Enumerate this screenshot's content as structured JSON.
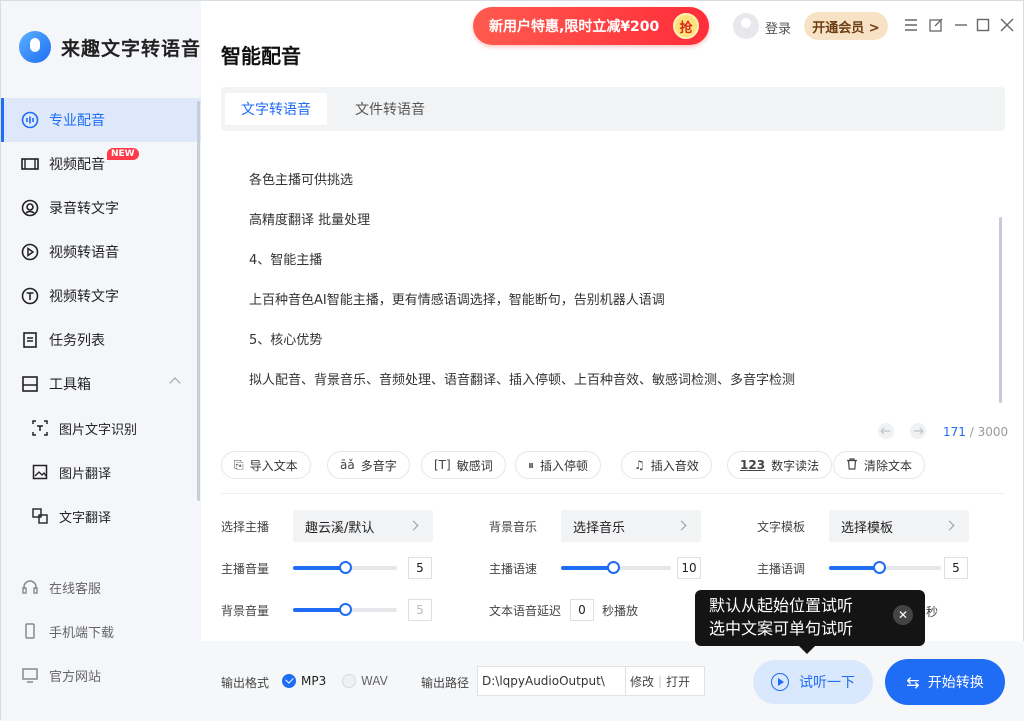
{
  "app": {
    "name": "来趣文字转语音",
    "page_title": "智能配音"
  },
  "header": {
    "promo_text": "新用户特惠,限时立减¥200",
    "promo_grab": "抢",
    "login": "登录",
    "vip": "开通会员 >",
    "window_controls": [
      "menu-icon",
      "feedback-icon",
      "minimize-icon",
      "maximize-icon",
      "close-icon"
    ]
  },
  "sidebar": {
    "items": [
      {
        "label": "专业配音",
        "icon": "voice-icon",
        "active": true
      },
      {
        "label": "视频配音",
        "icon": "video-icon",
        "badge": "NEW"
      },
      {
        "label": "录音转文字",
        "icon": "record-icon"
      },
      {
        "label": "视频转语音",
        "icon": "video-voice-icon"
      },
      {
        "label": "视频转文字",
        "icon": "video-text-icon"
      },
      {
        "label": "任务列表",
        "icon": "task-list-icon"
      },
      {
        "label": "工具箱",
        "icon": "toolbox-icon",
        "expanded": true
      }
    ],
    "sub_items": [
      {
        "label": "图片文字识别",
        "icon": "ocr-icon"
      },
      {
        "label": "图片翻译",
        "icon": "image-icon"
      },
      {
        "label": "文字翻译",
        "icon": "translate-icon"
      }
    ],
    "bottom": [
      {
        "label": "在线客服",
        "icon": "headset-icon"
      },
      {
        "label": "手机端下载",
        "icon": "phone-icon"
      },
      {
        "label": "官方网站",
        "icon": "monitor-icon"
      }
    ]
  },
  "tabs": [
    {
      "label": "文字转语音",
      "active": true
    },
    {
      "label": "文件转语音"
    }
  ],
  "editor": {
    "lines": [
      "各色主播可供挑选",
      "高精度翻译 批量处理",
      "4、智能主播",
      "上百种音色AI智能主播，更有情感语调选择，智能断句，告别机器人语调",
      "5、核心优势",
      "拟人配音、背景音乐、音频处理、语音翻译、插入停顿、上百种音效、敏感词检测、多音字检测"
    ],
    "char_count": "171",
    "char_limit": "/ 3000"
  },
  "toolbar": [
    {
      "label": "导入文本",
      "icon": "import-icon",
      "glyph": "⎘"
    },
    {
      "label": "多音字",
      "icon": "polyphone-icon",
      "glyph": "āǎ"
    },
    {
      "label": "敏感词",
      "icon": "sensitive-icon",
      "glyph": "[T]"
    },
    {
      "label": "插入停顿",
      "icon": "pause-icon",
      "glyph": "⏸"
    },
    {
      "label": "插入音效",
      "icon": "music-icon",
      "glyph": "♫"
    },
    {
      "label": "数字读法",
      "icon": "number-icon",
      "glyph": "123"
    },
    {
      "label": "清除文本",
      "icon": "trash-icon",
      "glyph": "🗑"
    }
  ],
  "settings": {
    "anchor_label": "选择主播",
    "anchor_value": "趣云溪/默认",
    "bgm_label": "背景音乐",
    "bgm_value": "选择音乐",
    "template_label": "文字模板",
    "template_value": "选择模板",
    "anchor_volume_label": "主播音量",
    "anchor_volume": "5",
    "anchor_volume_level": 0.5,
    "speed_label": "主播语速",
    "speed": "10",
    "speed_level": 0.47,
    "pitch_label": "主播语调",
    "pitch": "5",
    "pitch_level": 0.45,
    "bg_volume_label": "背景音量",
    "bg_volume": "5",
    "bg_volume_level": 0.5,
    "delay_label": "文本语音延迟",
    "delay": "0",
    "delay_unit": "秒播放"
  },
  "footer": {
    "format_label": "输出格式",
    "format_mp3": "MP3",
    "format_wav": "WAV",
    "path_label": "输出路径",
    "path_value": "D:\\lqpyAudioOutput\\",
    "modify": "修改",
    "open": "打开",
    "listen": "试听一下",
    "start": "开始转换"
  },
  "tooltip": {
    "line1": "默认从起始位置试听",
    "line2": "选中文案可单句试听",
    "peek": "秒"
  },
  "colors": {
    "accent": "#1f6cf5",
    "promo": "#ff3b4a",
    "vip_bg": "#f7e2c6"
  }
}
